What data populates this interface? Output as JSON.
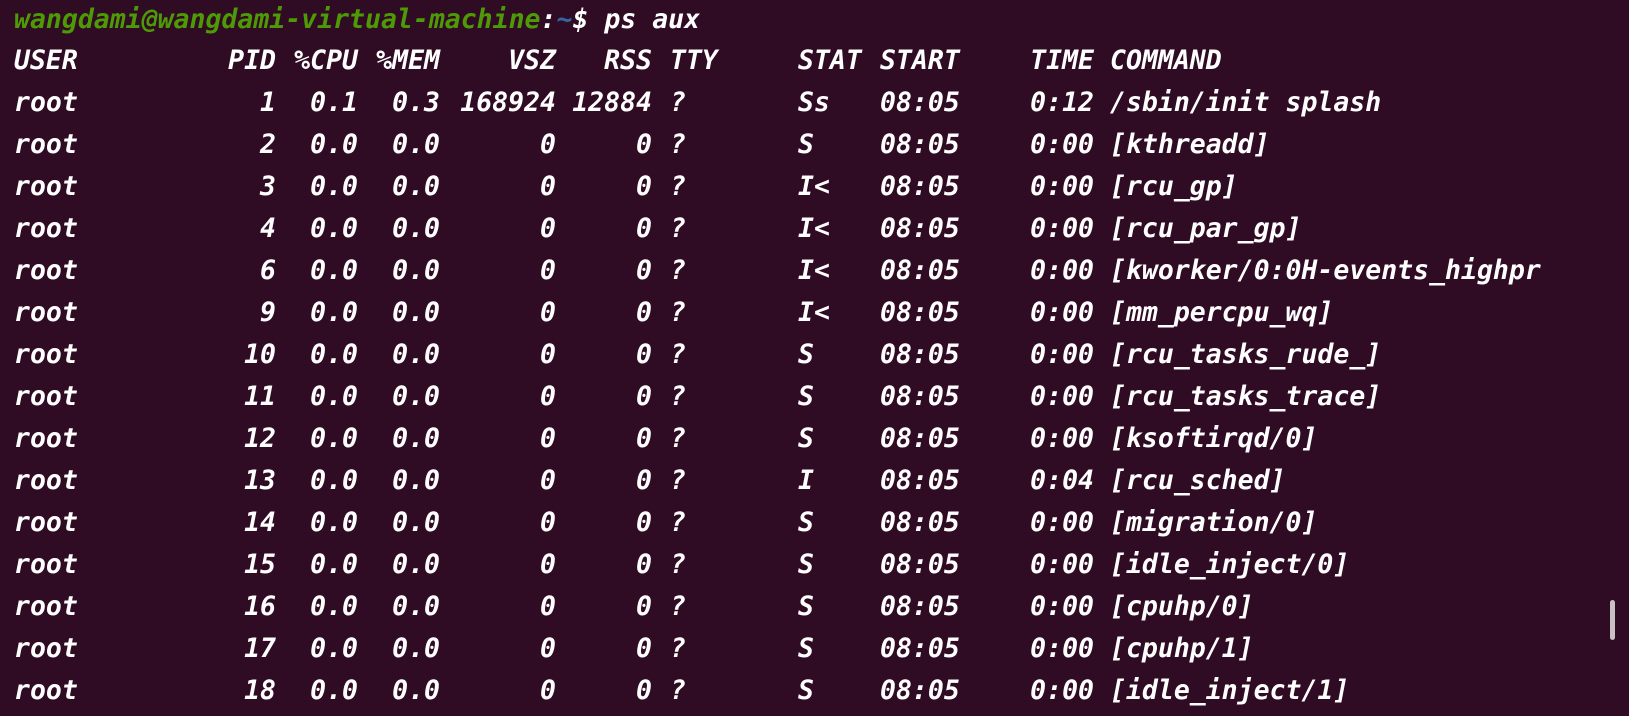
{
  "prompt": {
    "user_host": "wangdami@wangdami-virtual-machine",
    "colon": ":",
    "path": "~",
    "dollar": "$",
    "command": " ps aux"
  },
  "table": {
    "headers": {
      "user": "USER",
      "pid": "PID",
      "cpu": "%CPU",
      "mem": "%MEM",
      "vsz": "VSZ",
      "rss": "RSS",
      "tty": "TTY",
      "stat": "STAT",
      "start": "START",
      "time": "TIME",
      "command": "COMMAND"
    },
    "rows": [
      {
        "user": "root",
        "pid": "1",
        "cpu": "0.1",
        "mem": "0.3",
        "vsz": "168924",
        "rss": "12884",
        "tty": "?",
        "stat": "Ss",
        "start": "08:05",
        "time": "0:12",
        "command": "/sbin/init splash"
      },
      {
        "user": "root",
        "pid": "2",
        "cpu": "0.0",
        "mem": "0.0",
        "vsz": "0",
        "rss": "0",
        "tty": "?",
        "stat": "S",
        "start": "08:05",
        "time": "0:00",
        "command": "[kthreadd]"
      },
      {
        "user": "root",
        "pid": "3",
        "cpu": "0.0",
        "mem": "0.0",
        "vsz": "0",
        "rss": "0",
        "tty": "?",
        "stat": "I<",
        "start": "08:05",
        "time": "0:00",
        "command": "[rcu_gp]"
      },
      {
        "user": "root",
        "pid": "4",
        "cpu": "0.0",
        "mem": "0.0",
        "vsz": "0",
        "rss": "0",
        "tty": "?",
        "stat": "I<",
        "start": "08:05",
        "time": "0:00",
        "command": "[rcu_par_gp]"
      },
      {
        "user": "root",
        "pid": "6",
        "cpu": "0.0",
        "mem": "0.0",
        "vsz": "0",
        "rss": "0",
        "tty": "?",
        "stat": "I<",
        "start": "08:05",
        "time": "0:00",
        "command": "[kworker/0:0H-events_highpr"
      },
      {
        "user": "root",
        "pid": "9",
        "cpu": "0.0",
        "mem": "0.0",
        "vsz": "0",
        "rss": "0",
        "tty": "?",
        "stat": "I<",
        "start": "08:05",
        "time": "0:00",
        "command": "[mm_percpu_wq]"
      },
      {
        "user": "root",
        "pid": "10",
        "cpu": "0.0",
        "mem": "0.0",
        "vsz": "0",
        "rss": "0",
        "tty": "?",
        "stat": "S",
        "start": "08:05",
        "time": "0:00",
        "command": "[rcu_tasks_rude_]"
      },
      {
        "user": "root",
        "pid": "11",
        "cpu": "0.0",
        "mem": "0.0",
        "vsz": "0",
        "rss": "0",
        "tty": "?",
        "stat": "S",
        "start": "08:05",
        "time": "0:00",
        "command": "[rcu_tasks_trace]"
      },
      {
        "user": "root",
        "pid": "12",
        "cpu": "0.0",
        "mem": "0.0",
        "vsz": "0",
        "rss": "0",
        "tty": "?",
        "stat": "S",
        "start": "08:05",
        "time": "0:00",
        "command": "[ksoftirqd/0]"
      },
      {
        "user": "root",
        "pid": "13",
        "cpu": "0.0",
        "mem": "0.0",
        "vsz": "0",
        "rss": "0",
        "tty": "?",
        "stat": "I",
        "start": "08:05",
        "time": "0:04",
        "command": "[rcu_sched]"
      },
      {
        "user": "root",
        "pid": "14",
        "cpu": "0.0",
        "mem": "0.0",
        "vsz": "0",
        "rss": "0",
        "tty": "?",
        "stat": "S",
        "start": "08:05",
        "time": "0:00",
        "command": "[migration/0]"
      },
      {
        "user": "root",
        "pid": "15",
        "cpu": "0.0",
        "mem": "0.0",
        "vsz": "0",
        "rss": "0",
        "tty": "?",
        "stat": "S",
        "start": "08:05",
        "time": "0:00",
        "command": "[idle_inject/0]"
      },
      {
        "user": "root",
        "pid": "16",
        "cpu": "0.0",
        "mem": "0.0",
        "vsz": "0",
        "rss": "0",
        "tty": "?",
        "stat": "S",
        "start": "08:05",
        "time": "0:00",
        "command": "[cpuhp/0]"
      },
      {
        "user": "root",
        "pid": "17",
        "cpu": "0.0",
        "mem": "0.0",
        "vsz": "0",
        "rss": "0",
        "tty": "?",
        "stat": "S",
        "start": "08:05",
        "time": "0:00",
        "command": "[cpuhp/1]"
      },
      {
        "user": "root",
        "pid": "18",
        "cpu": "0.0",
        "mem": "0.0",
        "vsz": "0",
        "rss": "0",
        "tty": "?",
        "stat": "S",
        "start": "08:05",
        "time": "0:00",
        "command": "[idle_inject/1]"
      }
    ]
  },
  "colors": {
    "background": "#2f0b24",
    "prompt_user": "#4e9a06",
    "prompt_path": "#3465a4",
    "text": "#ffffff"
  }
}
